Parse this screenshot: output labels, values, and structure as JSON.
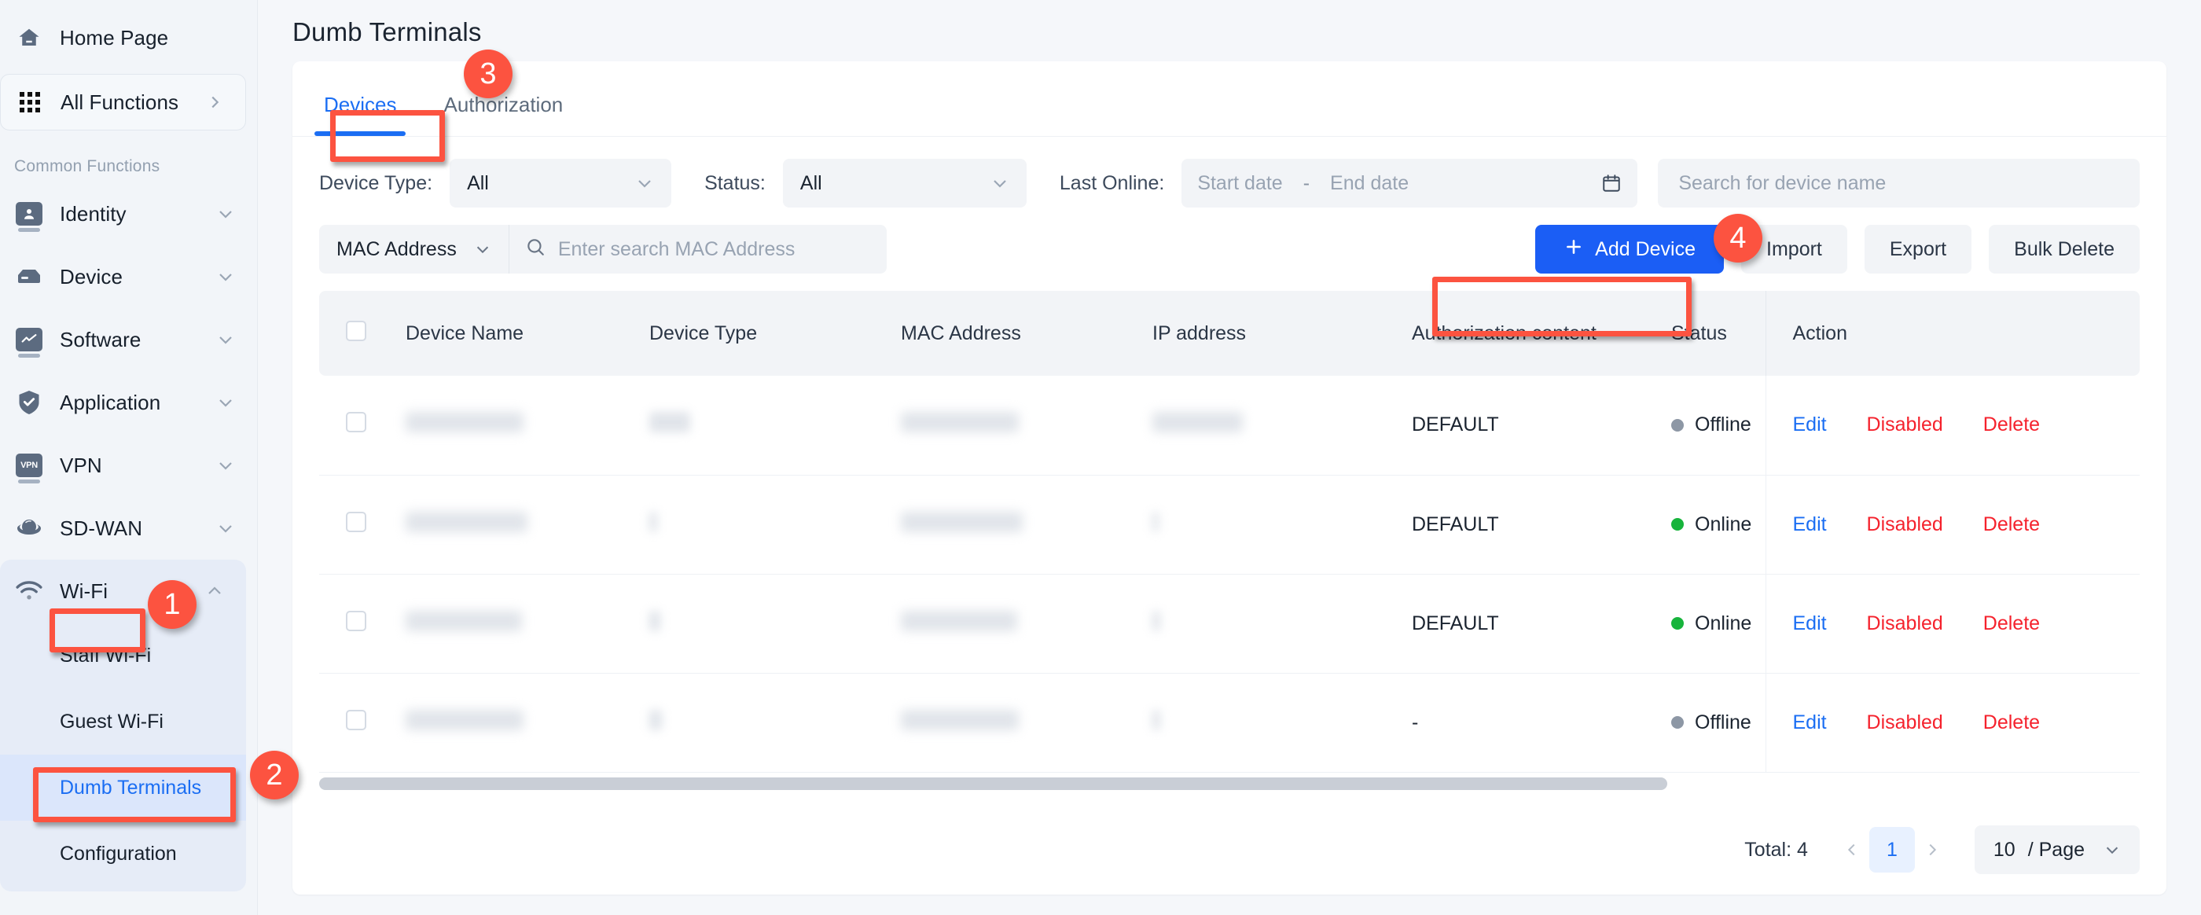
{
  "sidebar": {
    "home": {
      "label": "Home Page",
      "icon": "home-icon"
    },
    "all_functions": {
      "label": "All Functions",
      "icon": "grid-icon",
      "caret": "chevron-right-icon"
    },
    "section_label": "Common Functions",
    "items": [
      {
        "label": "Identity",
        "icon": "user-icon",
        "caret": "chevron-down-icon"
      },
      {
        "label": "Device",
        "icon": "server-icon",
        "caret": "chevron-down-icon"
      },
      {
        "label": "Software",
        "icon": "chart-icon",
        "caret": "chevron-down-icon"
      },
      {
        "label": "Application",
        "icon": "shield-icon",
        "caret": "chevron-down-icon"
      },
      {
        "label": "VPN",
        "icon": "vpn-icon",
        "caret": "chevron-down-icon"
      },
      {
        "label": "SD-WAN",
        "icon": "globe-icon",
        "caret": "chevron-down-icon"
      },
      {
        "label": "Wi-Fi",
        "icon": "wifi-icon",
        "caret": "chevron-up-icon"
      }
    ],
    "wifi_children": [
      {
        "label": "Staff Wi-Fi",
        "active": false
      },
      {
        "label": "Guest Wi-Fi",
        "active": false
      },
      {
        "label": "Dumb Terminals",
        "active": true
      },
      {
        "label": "Configuration",
        "active": false
      }
    ]
  },
  "header": {
    "title": "Dumb Terminals"
  },
  "tabs": [
    {
      "label": "Devices",
      "active": true
    },
    {
      "label": "Authorization",
      "active": false
    }
  ],
  "filters": {
    "device_type": {
      "label": "Device Type:",
      "value": "All",
      "caret": "chevron-down-icon"
    },
    "status": {
      "label": "Status:",
      "value": "All",
      "caret": "chevron-down-icon"
    },
    "last_online": {
      "label": "Last Online:",
      "start_placeholder": "Start date",
      "separator": "-",
      "end_placeholder": "End date",
      "icon": "calendar-icon"
    },
    "device_search": {
      "placeholder": "Search for device name"
    },
    "mac_filter": {
      "field": "MAC Address",
      "caret": "chevron-down-icon",
      "icon": "search-icon",
      "placeholder": "Enter search MAC Address"
    }
  },
  "toolbar": {
    "add_device": {
      "label": "Add Device",
      "icon": "plus-icon"
    },
    "import": "Import",
    "export": "Export",
    "bulk_delete": "Bulk Delete"
  },
  "table": {
    "columns": [
      "Device Name",
      "Device Type",
      "MAC Address",
      "IP address",
      "Authorization content",
      "Status",
      "Action"
    ],
    "actions": {
      "edit": "Edit",
      "disable": "Disabled",
      "delete": "Delete"
    },
    "rows": [
      {
        "device_name": "",
        "device_type": "",
        "mac_address": "",
        "ip_address": "",
        "authorization_content": "DEFAULT",
        "status": "Offline",
        "status_state": "offline",
        "redacted": true,
        "widths": {
          "name": 150,
          "type": 52,
          "mac": 150,
          "ip": 115
        }
      },
      {
        "device_name": "",
        "device_type": "",
        "mac_address": "",
        "ip_address": "",
        "authorization_content": "DEFAULT",
        "status": "Online",
        "status_state": "online",
        "redacted": true,
        "widths": {
          "name": 155,
          "type": 10,
          "mac": 155,
          "ip": 8
        }
      },
      {
        "device_name": "",
        "device_type": "",
        "mac_address": "",
        "ip_address": "",
        "authorization_content": "DEFAULT",
        "status": "Online",
        "status_state": "online",
        "redacted": true,
        "widths": {
          "name": 148,
          "type": 14,
          "mac": 148,
          "ip": 10
        }
      },
      {
        "device_name": "",
        "device_type": "",
        "mac_address": "",
        "ip_address": "",
        "authorization_content": "-",
        "status": "Offline",
        "status_state": "offline",
        "redacted": true,
        "widths": {
          "name": 150,
          "type": 16,
          "mac": 150,
          "ip": 10
        }
      }
    ]
  },
  "pagination": {
    "total": "Total: 4",
    "prev": "‹",
    "page": "1",
    "next": "›",
    "page_size": "10",
    "page_size_suffix": "/ Page",
    "caret": "chevron-down-icon"
  },
  "annotations": {
    "badges": [
      {
        "number": "1",
        "target": "wifi-nav-item"
      },
      {
        "number": "2",
        "target": "dumb-terminals-nav-item"
      },
      {
        "number": "3",
        "target": "devices-tab"
      },
      {
        "number": "4",
        "target": "device-search-input"
      }
    ],
    "accent_color": "#fc5340",
    "primary_color": "#1b5ef5"
  }
}
